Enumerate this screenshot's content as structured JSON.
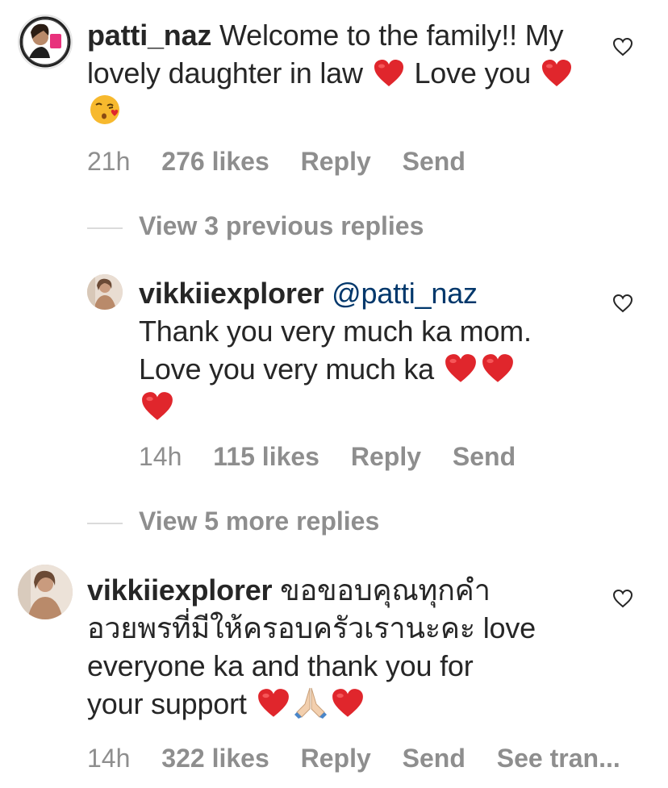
{
  "comments": [
    {
      "username": "patti_naz",
      "text_parts": [
        "Welcome to the family!! My lovely daughter in law",
        "Love you"
      ],
      "time": "21h",
      "likes": "276 likes",
      "reply": "Reply",
      "send": "Send"
    },
    {
      "username": "vikkiiexplorer",
      "mention": "@patti_naz",
      "line1": "Thank you very much ka mom.",
      "line2": "Love you very much ka",
      "time": "14h",
      "likes": "115 likes",
      "reply": "Reply",
      "send": "Send"
    },
    {
      "username": "vikkiiexplorer",
      "text_line1": "ขอขอบคุณทุกคำ",
      "text_line2": "อวยพรที่มีให้ครอบครัวเรานะคะ love",
      "text_line3": "everyone ka and thank you for",
      "text_line4": "your support",
      "time": "14h",
      "likes": "322 likes",
      "reply": "Reply",
      "send": "Send",
      "see_translation": "See tran..."
    }
  ],
  "view_previous_replies": "View 3 previous replies",
  "view_more_replies": "View 5 more replies",
  "icons": {
    "like": "heart-outline-icon",
    "red_heart": "red-heart-emoji",
    "kiss_face": "face-blowing-kiss-emoji",
    "folded_hands": "folded-hands-emoji"
  },
  "colors": {
    "text": "#262626",
    "muted": "#8e8e8e",
    "mention": "#00376b",
    "heart": "#e0262c"
  }
}
